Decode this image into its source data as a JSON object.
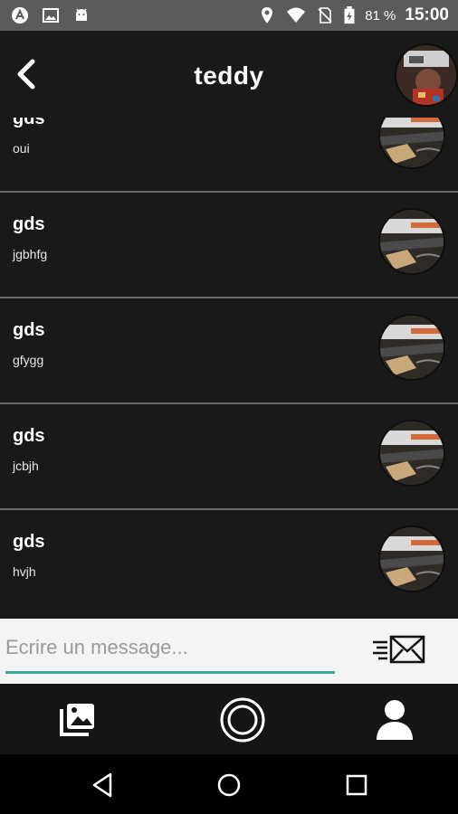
{
  "status_bar": {
    "battery_percent": "81 %",
    "time": "15:00",
    "icons_left": [
      "app-notification-icon",
      "image-notification-icon",
      "android-notification-icon"
    ],
    "icons_right": [
      "location-icon",
      "wifi-icon",
      "no-sim-icon",
      "battery-charging-icon"
    ]
  },
  "header": {
    "title": "teddy",
    "back_icon": "chevron-left-icon"
  },
  "messages": [
    {
      "name": "gds",
      "text": "oui"
    },
    {
      "name": "gds",
      "text": "jgbhfg"
    },
    {
      "name": "gds",
      "text": "gfygg"
    },
    {
      "name": "gds",
      "text": "jcbjh"
    },
    {
      "name": "gds",
      "text": "hvjh"
    }
  ],
  "composer": {
    "placeholder": "Ecrire un message...",
    "value": "",
    "send_icon": "send-mail-icon"
  },
  "tabs": [
    {
      "icon": "gallery-icon"
    },
    {
      "icon": "camera-ring-icon"
    },
    {
      "icon": "profile-icon"
    }
  ],
  "nav": [
    "back-triangle-icon",
    "home-circle-icon",
    "recents-square-icon"
  ],
  "colors": {
    "background": "#191919",
    "accent": "#3aa89a",
    "status_bar": "#5b5b5b"
  }
}
